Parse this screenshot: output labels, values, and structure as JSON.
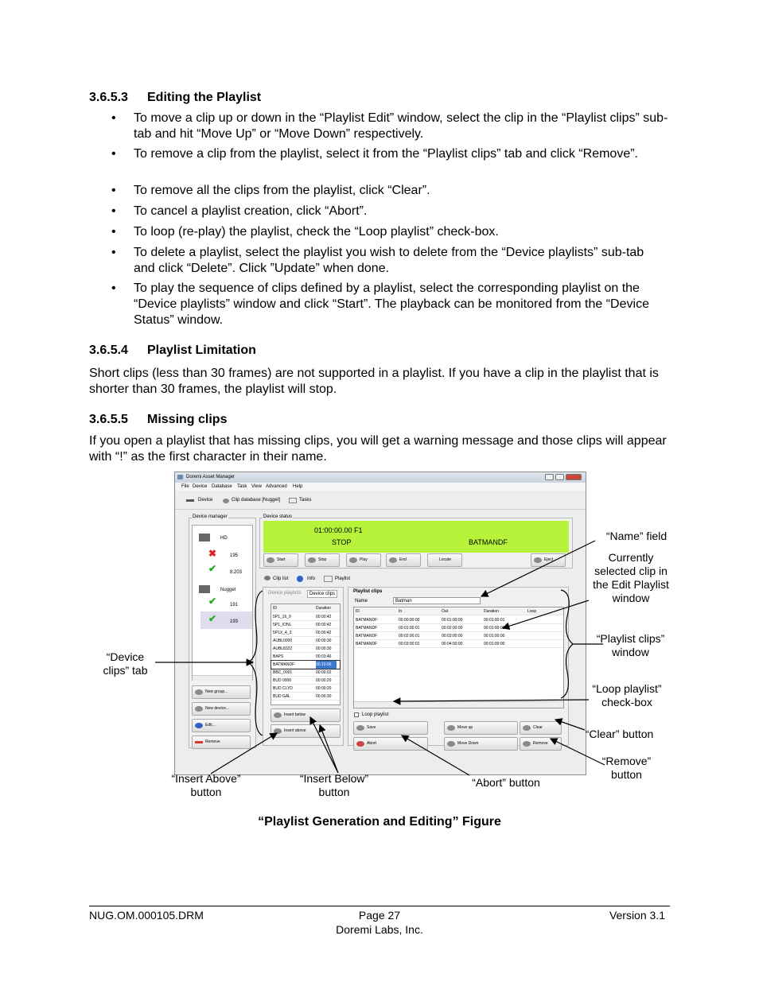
{
  "sections": {
    "s1": {
      "number": "3.6.5.3",
      "title": "Editing the Playlist"
    },
    "bullets": [
      "To move a clip up or down in the “Playlist Edit” window, select the clip in the “Playlist clips” sub-tab and hit “Move Up” or “Move Down” respectively.",
      "To remove a clip from the playlist, select it from the “Playlist clips” tab and click “Remove”.",
      "To remove all the clips from the playlist, click “Clear”.",
      "To cancel a playlist creation, click “Abort”.",
      "To loop (re-play) the playlist, check the “Loop playlist” check-box.",
      "To delete a playlist, select the playlist you wish to delete from the “Device playlists” sub-tab and click “Delete”. Click ”Update” when done.",
      "To play the sequence of clips defined by a playlist, select the corresponding playlist on the “Device playlists” window and click “Start”. The playback can be monitored from the “Device Status” window."
    ],
    "bullet_char": "•",
    "s2": {
      "number": "3.6.5.4",
      "title": "Playlist Limitation",
      "text": "Short clips (less than 30 frames) are not supported in a playlist. If you have a clip in the playlist that is shorter than 30 frames, the playlist will stop."
    },
    "s3": {
      "number": "3.6.5.5",
      "title": "Missing clips",
      "text": "If you open a playlist that has missing clips, you will get a warning message and those clips will appear with “!” as the first character in their name."
    }
  },
  "figure": {
    "window_title": "Doremi Asset Manager",
    "menu": [
      "File",
      "Device",
      "Database",
      "Task",
      "View",
      "Advanced",
      "Help"
    ],
    "tabs": [
      "Device",
      "Clip database [Nugget]",
      "Tasks"
    ],
    "device_manager_label": "Device manager",
    "tree": [
      "HD",
      "195",
      "8.203",
      "Nugget",
      "191",
      "193"
    ],
    "left_buttons": [
      "New group...",
      "New device...",
      "Edit...",
      "Remove"
    ],
    "device_status_label": "Device status",
    "timecode": "01:00:00.00 F1",
    "state": "STOP",
    "clip_name": "BATMANDF",
    "transport": [
      "Start",
      "Stop",
      "Play",
      "End",
      "Locate",
      "Eject"
    ],
    "subtabs": [
      "Clip list",
      "Info",
      "Playlist"
    ],
    "clip_tabs": [
      "Device playlists",
      "Device clips"
    ],
    "clip_headers": [
      "ID",
      "Duration"
    ],
    "clips": [
      [
        "5P1_16_9",
        "00:00:42"
      ],
      [
        "5P1_IONL",
        "00:00:42"
      ],
      [
        "5P1X_4_3",
        "00:00:42"
      ],
      [
        "AUBL0000",
        "00:00:30"
      ],
      [
        "AUBL8322",
        "00:00:30"
      ],
      [
        "BAPS",
        "00:03:46"
      ],
      [
        "BATMANDF",
        "00:10:00"
      ],
      [
        "BBC_0001",
        "00:00:02"
      ],
      [
        "BUD 0000",
        "00:00:20"
      ],
      [
        "BUD CLYD",
        "00:00:20"
      ],
      [
        "BUD GAL",
        "00:00:30"
      ]
    ],
    "insert_buttons": [
      "Insert below",
      "Insert above"
    ],
    "playlist_clips_label": "Playlist clips",
    "name_label": "Name",
    "name_value": "Batman",
    "pl_headers": [
      "ID",
      "In",
      "Out",
      "Duration",
      "Loop"
    ],
    "pl_rows": [
      [
        "BATMANDF",
        "00:00:00:00",
        "00:01:00:00",
        "00:01:00:01"
      ],
      [
        "BATMANDF",
        "00:01:00:01",
        "00:02:00:00",
        "00:01:00:00"
      ],
      [
        "BATMANDF",
        "00:02:00:01",
        "00:03:00:00",
        "00:01:00:00"
      ],
      [
        "BATMANDF",
        "00:03:00:01",
        "00:04:00:00",
        "00:01:00:00"
      ]
    ],
    "loop_label": "Loop playlist",
    "pl_buttons": [
      "Save",
      "Move up",
      "Clear",
      "Abort",
      "Move Down",
      "Remove"
    ],
    "annotations": {
      "name": "“Name” field",
      "current": "Currently selected clip in the Edit Playlist window",
      "plclips": "“Playlist clips” window",
      "loop": "“Loop playlist” check-box",
      "clear": "“Clear” button",
      "remove": "“Remove” button",
      "device_clips": "“Device clips” tab",
      "insert_above": "“Insert Above” button",
      "insert_below": "“Insert Below” button",
      "abort": "“Abort” button"
    },
    "status_green": "#b6f33a"
  },
  "caption": {
    "bold": "“Playlist Generation and Editing",
    "rest": "” Figure"
  },
  "footer": {
    "doc": "NUG.OM.000105.DRM",
    "page": "Page 27",
    "company": "Doremi Labs, Inc.",
    "version": "Version 3.1"
  }
}
